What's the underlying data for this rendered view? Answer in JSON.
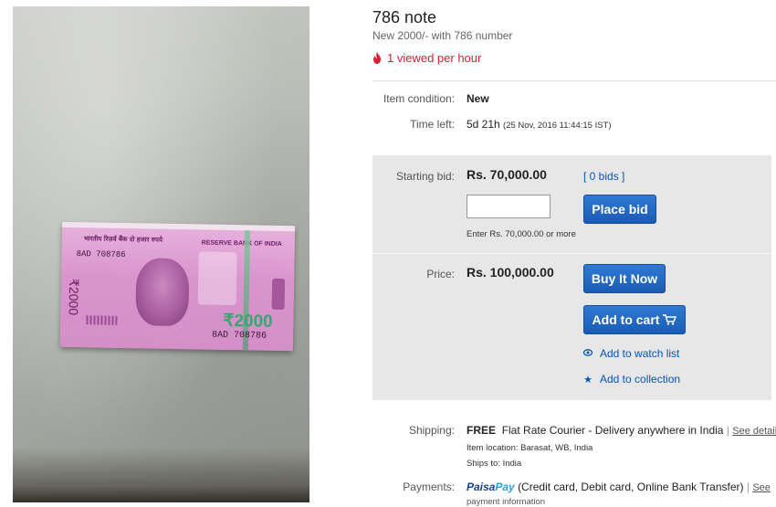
{
  "listing": {
    "title": "786 note",
    "subtitle": "New 2000/- with 786 number",
    "viewed": "1 viewed per hour"
  },
  "photo": {
    "note_top_text": "भारतीय रिज़र्व बैंक  दो हजार रुपये",
    "note_top_right": "RESERVE BANK OF INDIA",
    "serial_top": "8AD 708786",
    "serial_bottom": "8AD 708786",
    "denomination": "₹2000",
    "vertical_text": "₹2000"
  },
  "details": {
    "condition_label": "Item condition:",
    "condition_value": "New",
    "time_label": "Time left:",
    "time_value": "5d 21h",
    "time_detail": "(25 Nov, 2016  11:44:15 IST)"
  },
  "bidding": {
    "starting_bid_label": "Starting bid:",
    "starting_bid_value": "Rs. 70,000.00",
    "bids_link": "[ 0 bids ]",
    "input_value": "",
    "hint": "Enter Rs. 70,000.00 or more",
    "place_bid_label": "Place bid"
  },
  "buy": {
    "price_label": "Price:",
    "price_value": "Rs. 100,000.00",
    "buy_now_label": "Buy It Now",
    "add_to_cart_label": "Add to cart",
    "watch_list_label": "Add to watch list",
    "collection_label": "Add to collection"
  },
  "shipping": {
    "label": "Shipping:",
    "free": "FREE",
    "method": "Flat Rate Courier - Delivery anywhere in India",
    "see_details": "See details",
    "item_location": "Item location: Barasat, WB, India",
    "ships_to": "Ships to: India"
  },
  "payments": {
    "label": "Payments:",
    "brand_a": "Paisa",
    "brand_b": "Pay",
    "methods": "(Credit card, Debit card, Online Bank Transfer)",
    "see": "See",
    "more": "payment information"
  },
  "icons": {
    "flame": "flame-icon",
    "eye": "eye-icon",
    "star": "star-icon",
    "cart": "cart-icon"
  },
  "colors": {
    "accent_blue": "#0654ba",
    "button_blue": "#1a5cb5",
    "alert_red": "#dd1e31",
    "panel_gray": "#e7e7e7"
  }
}
